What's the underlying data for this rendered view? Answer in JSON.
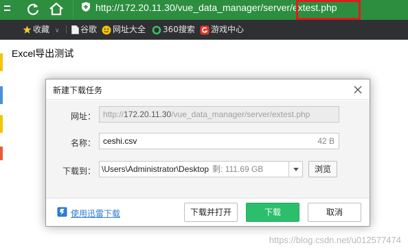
{
  "browser": {
    "url": "http://172.20.11.30/vue_data_manager/server/extest.php",
    "url_prefix": "http://172.20.11.30/vue_data_manager/server",
    "url_highlighted": "/extest.php",
    "colors": {
      "toolbar": "#2d8e3f",
      "bookmarks_bar": "#2e3033",
      "highlight_box": "#e01b1b"
    }
  },
  "bookmarks": [
    {
      "label": "收藏",
      "icon": "star-icon"
    },
    {
      "label": "谷歌",
      "icon": "page-icon"
    },
    {
      "label": "网址大全",
      "icon": "smiley-icon"
    },
    {
      "label": "360搜索",
      "icon": "ring-icon"
    },
    {
      "label": "游戏中心",
      "icon": "game-icon"
    }
  ],
  "page": {
    "title": "Excel导出测试"
  },
  "dialog": {
    "title": "新建下载任务",
    "url_label": "网址：",
    "url_value_prefix": "http://",
    "url_value_host": "172.20.11.30",
    "url_value_path": "/vue_data_manager/server/extest.php",
    "name_label": "名称：",
    "name_value": "ceshi.csv",
    "name_size": "42 B",
    "saveto_label": "下载到：",
    "saveto_path": "\\Users\\Administrator\\Desktop",
    "saveto_free": "剩: 111.69 GB",
    "browse_label": "浏览",
    "link_label": "使用迅雷下载",
    "download_open_label": "下载并打开",
    "download_label": "下载",
    "cancel_label": "取消",
    "accent_color": "#2bbf6c"
  },
  "watermark": "https://blog.csdn.net/u012577474"
}
